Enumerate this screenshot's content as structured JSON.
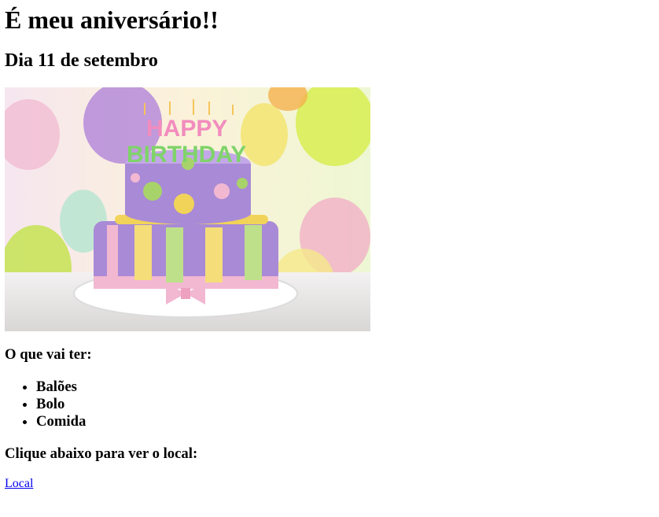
{
  "page": {
    "title": "É meu aniversário!!",
    "subtitle": "Dia 11 de setembro"
  },
  "image": {
    "cake_text_top": "HAPPY",
    "cake_text_bottom": "BIRTHDAY"
  },
  "what": {
    "heading": "O que vai ter:",
    "items": [
      "Balões",
      "Bolo",
      "Comida"
    ]
  },
  "location": {
    "heading": "Clique abaixo para ver o local:",
    "link_label": "Local"
  },
  "colors": {
    "link": "#0000ee",
    "cake_purple": "#a98ad6",
    "ribbon_pink": "#f2b8d2"
  }
}
